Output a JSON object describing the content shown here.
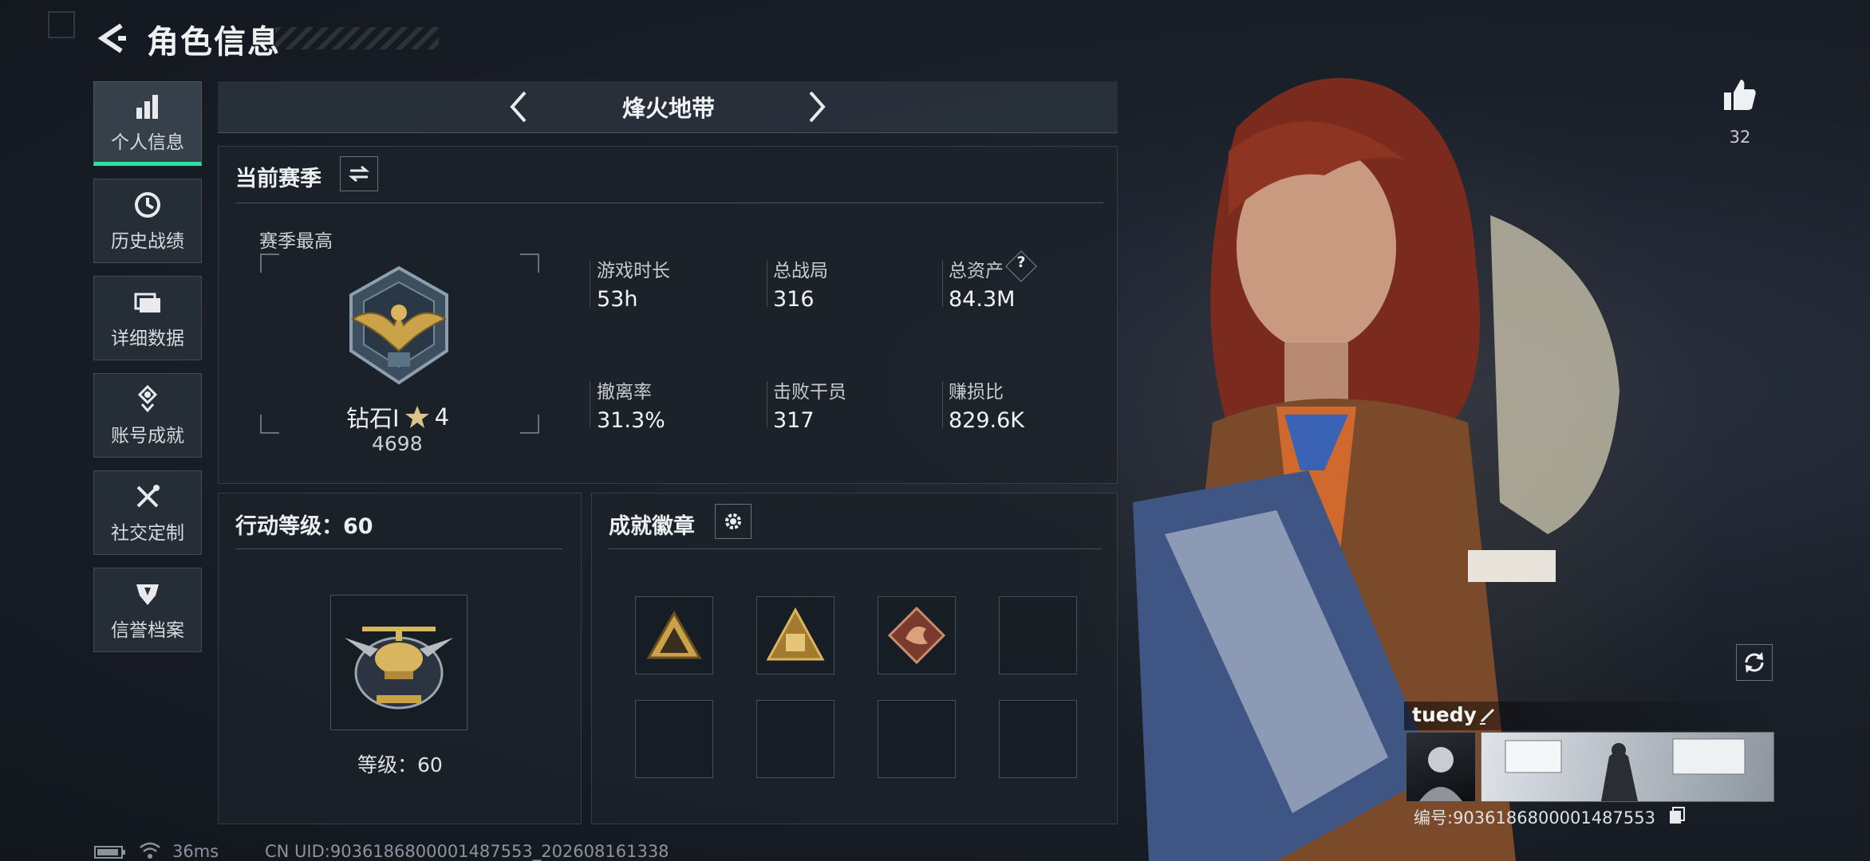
{
  "header": {
    "title": "角色信息"
  },
  "sidebar": {
    "items": [
      {
        "label": "个人信息"
      },
      {
        "label": "历史战绩"
      },
      {
        "label": "详细数据"
      },
      {
        "label": "账号成就"
      },
      {
        "label": "社交定制"
      },
      {
        "label": "信誉档案"
      }
    ]
  },
  "mode_selector": {
    "name": "烽火地带"
  },
  "season": {
    "title": "当前赛季",
    "best_label": "赛季最高",
    "rank_name": "钻石Ⅰ",
    "rank_stars": "4",
    "rank_points": "4698",
    "stats": [
      {
        "label": "游戏时长",
        "value": "53h"
      },
      {
        "label": "总战局",
        "value": "316"
      },
      {
        "label": "总资产",
        "value": "84.3M"
      },
      {
        "label": "撤离率",
        "value": "31.3%"
      },
      {
        "label": "击败干员",
        "value": "317"
      },
      {
        "label": "赚损比",
        "value": "829.6K"
      }
    ],
    "help_symbol": "?"
  },
  "action_level": {
    "title": "行动等级：60",
    "level_text": "等级：60"
  },
  "achievements": {
    "title": "成就徽章"
  },
  "likes": {
    "count": "32"
  },
  "profile": {
    "name": "tuedy",
    "id_text": "编号:9036186800001487553"
  },
  "footer": {
    "ping": "36ms",
    "uid": "CN UID:9036186800001487553_202608161338"
  },
  "colors": {
    "accent": "#27e39b",
    "gold": "#c9a24a"
  }
}
